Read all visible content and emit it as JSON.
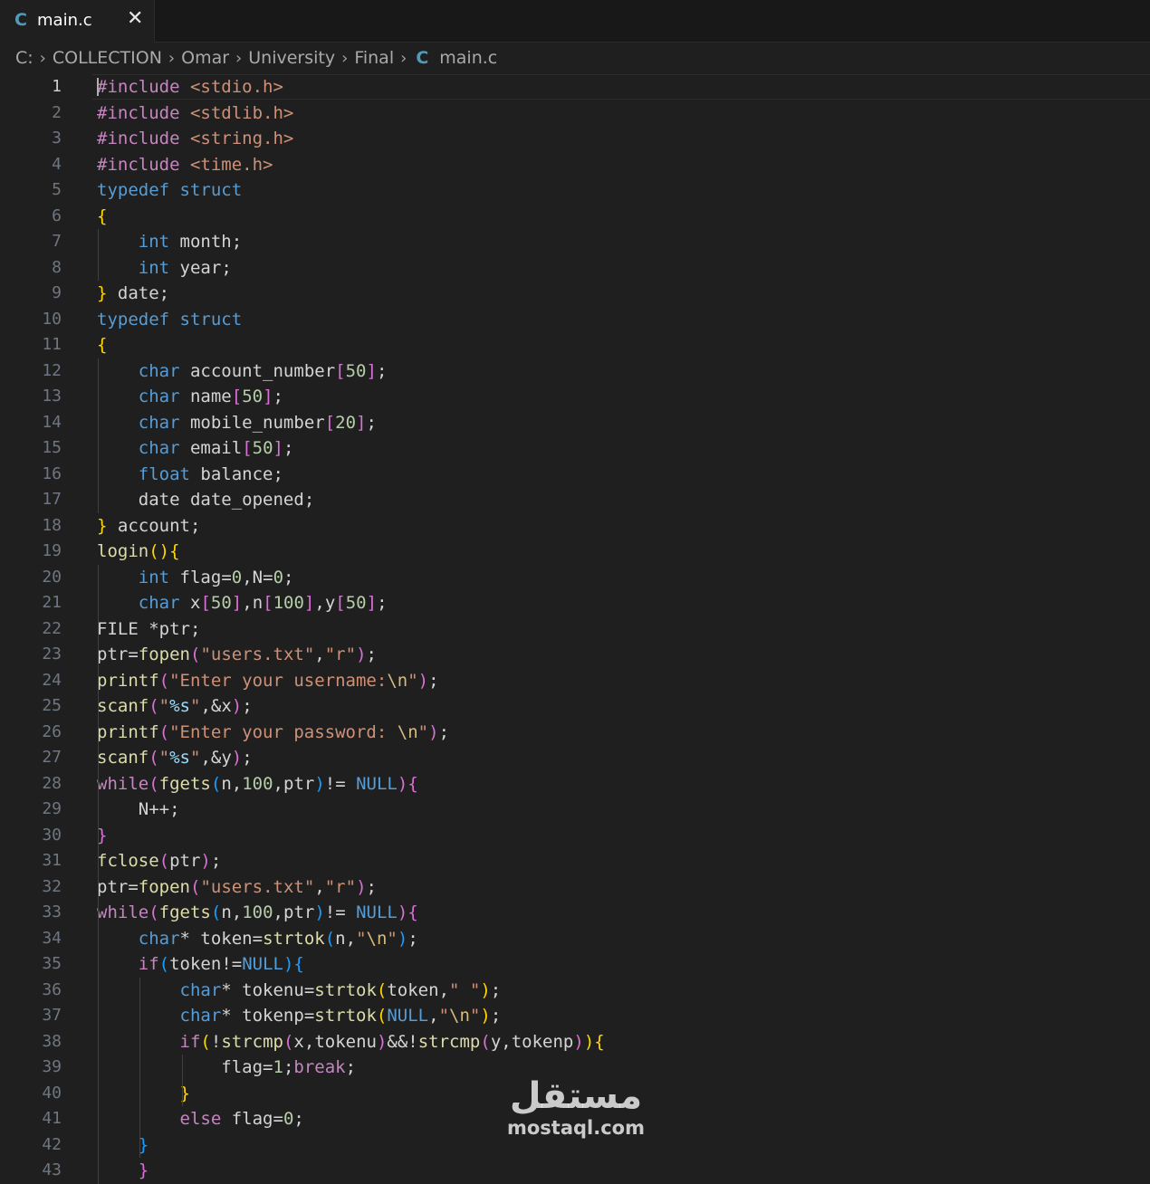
{
  "tab": {
    "icon": "C",
    "title": "main.c",
    "close_symbol": "✕"
  },
  "breadcrumb": {
    "segments": [
      "C:",
      "COLLECTION",
      "Omar",
      "University",
      "Final"
    ],
    "file_icon": "C",
    "file": "main.c"
  },
  "editor": {
    "active_line": 1,
    "line_numbers": [
      "1",
      "2",
      "3",
      "4",
      "5",
      "6",
      "7",
      "8",
      "9",
      "10",
      "11",
      "12",
      "13",
      "14",
      "15",
      "16",
      "17",
      "18",
      "19",
      "20",
      "21",
      "22",
      "23",
      "24",
      "25",
      "26",
      "27",
      "28",
      "29",
      "30",
      "31",
      "32",
      "33",
      "34",
      "35",
      "36",
      "37",
      "38",
      "39",
      "40",
      "41",
      "42",
      "43"
    ],
    "lines": [
      "#include <stdio.h>",
      "#include <stdlib.h>",
      "#include <string.h>",
      "#include <time.h>",
      "typedef struct",
      "{",
      "    int month;",
      "    int year;",
      "} date;",
      "typedef struct",
      "{",
      "    char account_number[50];",
      "    char name[50];",
      "    char mobile_number[20];",
      "    char email[50];",
      "    float balance;",
      "    date date_opened;",
      "} account;",
      "login(){",
      "    int flag=0,N=0;",
      "    char x[50],n[100],y[50];",
      "FILE *ptr;",
      "ptr=fopen(\"users.txt\",\"r\");",
      "printf(\"Enter your username:\\n\");",
      "scanf(\"%s\",&x);",
      "printf(\"Enter your password: \\n\");",
      "scanf(\"%s\",&y);",
      "while(fgets(n,100,ptr)!= NULL){",
      "    N++;",
      "}",
      "fclose(ptr);",
      "ptr=fopen(\"users.txt\",\"r\");",
      "while(fgets(n,100,ptr)!= NULL){",
      "    char* token=strtok(n,\"\\n\");",
      "    if(token!=NULL){",
      "        char* tokenu=strtok(token,\" \");",
      "        char* tokenp=strtok(NULL,\"\\n\");",
      "        if(!strcmp(x,tokenu)&&!strcmp(y,tokenp)){",
      "            flag=1;break;",
      "        }",
      "        else flag=0;",
      "    }",
      "    }"
    ]
  },
  "watermark": {
    "arabic": "مستقل",
    "latin": "mostaql.com"
  },
  "colors": {
    "background": "#1f1f1f",
    "keyword": "#569cd6",
    "function": "#dcdcaa",
    "string": "#ce9178",
    "number": "#b5cea8",
    "variable": "#9cdcfe",
    "control": "#c586c0",
    "bracket_1": "#ffd700",
    "bracket_2": "#da70d6",
    "bracket_3": "#179fff",
    "c_icon": "#519aba"
  }
}
